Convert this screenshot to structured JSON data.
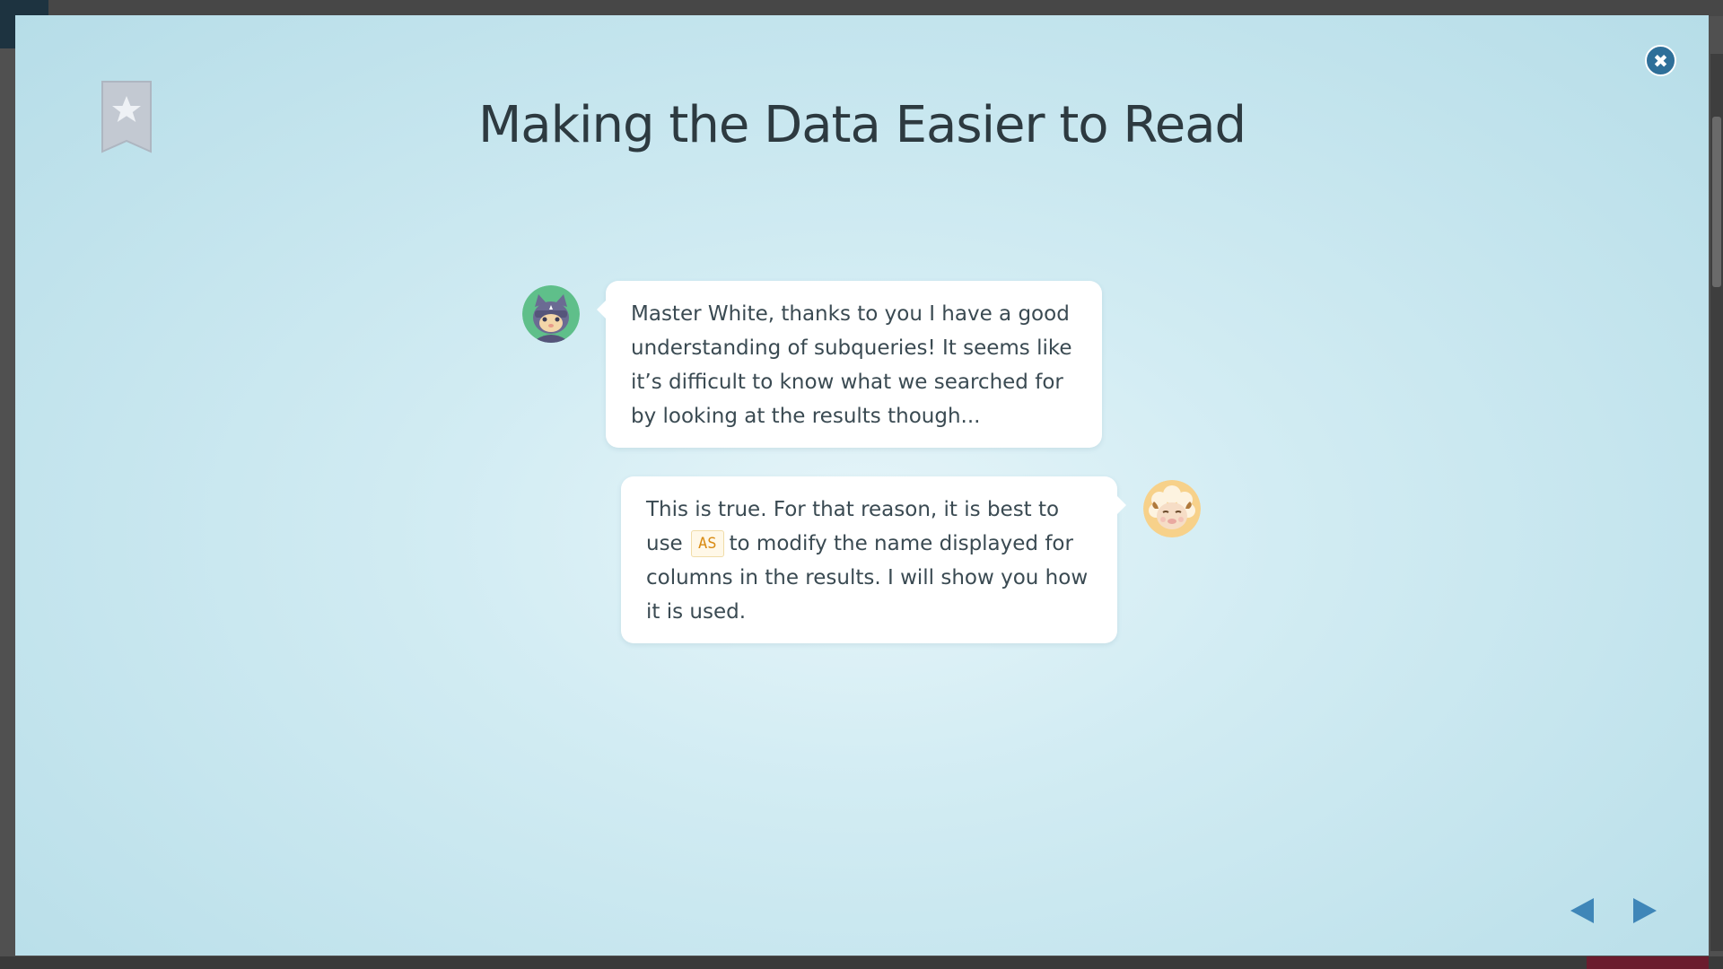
{
  "modal": {
    "title": "Making the Data Easier to Read",
    "bookmark_icon": "bookmark-star-icon",
    "close_icon": "close-icon",
    "close_glyph": "✖"
  },
  "dialogue": [
    {
      "speaker_avatar": "cat-ninja-avatar",
      "side": "left",
      "text": "Master White, thanks to you I have a good understanding of subqueries! It seems like it’s difficult to know what we searched for by looking at the results though..."
    },
    {
      "speaker_avatar": "sheep-master-white-avatar",
      "side": "right",
      "text_before": "This is true. For that reason, it is best to use",
      "code": "AS",
      "text_after": "to modify the name displayed for columns in the results. I will show you how it is used."
    }
  ],
  "navigation": {
    "prev_icon": "arrow-left-icon",
    "next_icon": "arrow-right-icon"
  },
  "colors": {
    "accent": "#3f86b8",
    "close_button": "#2e6f99",
    "code_text": "#d98b14",
    "title_text": "#2d3a40"
  }
}
